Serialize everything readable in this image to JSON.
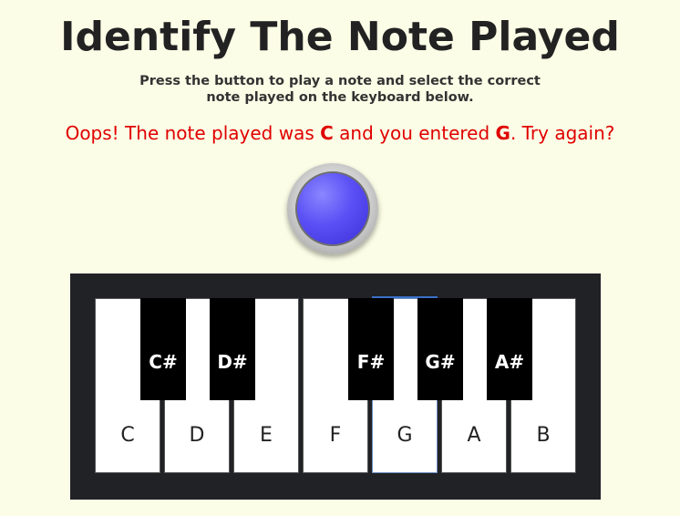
{
  "header": {
    "title": "Identify The Note Played",
    "instruction_line1": "Press the button to play a note and select the correct",
    "instruction_line2": "note played on the keyboard below."
  },
  "feedback": {
    "prefix": "Oops! The note played was ",
    "played_note": "C",
    "middle": " and you entered ",
    "entered_note": "G",
    "suffix": ". Try again?"
  },
  "play_button": {
    "icon": "circle-play-button"
  },
  "keyboard": {
    "white_keys": [
      "C",
      "D",
      "E",
      "F",
      "G",
      "A",
      "B"
    ],
    "black_keys": [
      "C#",
      "D#",
      "F#",
      "G#",
      "A#"
    ],
    "selected_key": "G"
  },
  "colors": {
    "background": "#fbfde6",
    "feedback_text": "#e00000",
    "button_core": "#5a50f5",
    "keyboard_frame": "#212226"
  }
}
